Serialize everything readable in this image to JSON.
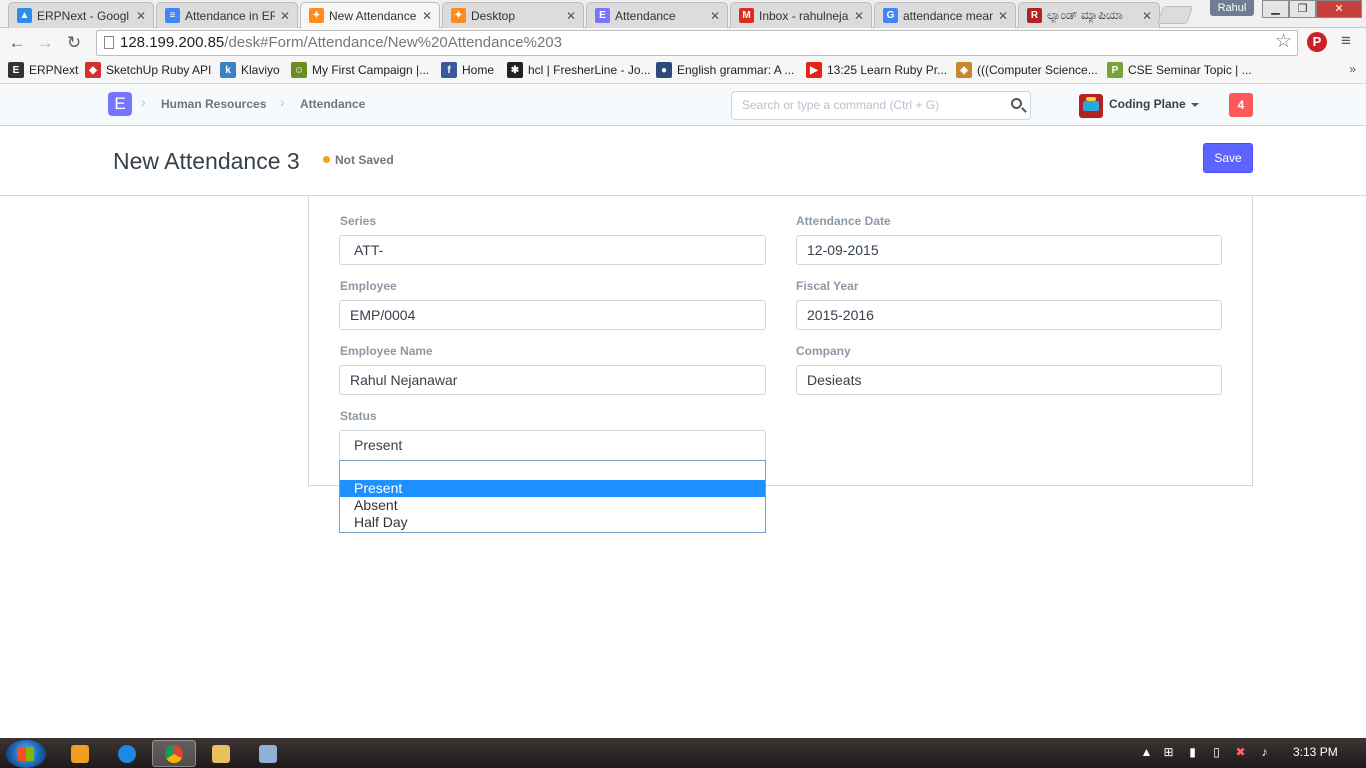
{
  "browser": {
    "tabs": [
      {
        "label": "ERPNext - Googl",
        "icon": "google-drive-icon",
        "color": "#2d8cf0"
      },
      {
        "label": "Attendance in ER",
        "icon": "google-docs-icon",
        "color": "#4285f4"
      },
      {
        "label": "New Attendance",
        "icon": "erpnext-desk-icon",
        "color": "#ff8c1a"
      },
      {
        "label": "Desktop",
        "icon": "erpnext-desk-icon",
        "color": "#ff8c1a"
      },
      {
        "label": "Attendance",
        "icon": "erpnext-e-icon",
        "color": "#7575ff"
      },
      {
        "label": "Inbox - rahulneja",
        "icon": "gmail-icon",
        "color": "#d93025"
      },
      {
        "label": "attendance mean",
        "icon": "google-icon",
        "color": "#4285f4"
      },
      {
        "label": "ಲ್ಯಾಂಡ್ ಮ್ಯಾಪಿಯಾ",
        "icon": "r-icon",
        "color": "#b22222"
      }
    ],
    "user_badge": "Rahul",
    "url_host": "128.199.200.85",
    "url_path": "/desk#Form/Attendance/New%20Attendance%203",
    "bookmarks": [
      {
        "label": "ERPNext",
        "icon": "erpnext-e-icon",
        "color": "#333"
      },
      {
        "label": "SketchUp Ruby API",
        "icon": "sketchup-icon",
        "color": "#d32f2f"
      },
      {
        "label": "Klaviyo",
        "icon": "klaviyo-icon",
        "color": "#3b82c4"
      },
      {
        "label": "My First Campaign |...",
        "icon": "campaign-icon",
        "color": "#6b8e23"
      },
      {
        "label": "Home",
        "icon": "facebook-icon",
        "color": "#3b5998"
      },
      {
        "label": "hcl | FresherLine - Jo...",
        "icon": "runner-icon",
        "color": "#222"
      },
      {
        "label": "English grammar: A ...",
        "icon": "bug-icon",
        "color": "#2e4a7a"
      },
      {
        "label": "13:25 Learn Ruby Pr...",
        "icon": "youtube-icon",
        "color": "#e62117"
      },
      {
        "label": "(((Computer Science...",
        "icon": "shield-icon",
        "color": "#c8872d"
      },
      {
        "label": "CSE Seminar Topic | ...",
        "icon": "p-icon",
        "color": "#7aa33a"
      }
    ]
  },
  "app": {
    "logo_letter": "E",
    "breadcrumbs": [
      "Human Resources",
      "Attendance"
    ],
    "search_placeholder": "Search or type a command (Ctrl + G)",
    "user_name": "Coding Plane",
    "notification_count": "4"
  },
  "page": {
    "title": "New Attendance 3",
    "status": "Not Saved",
    "save_label": "Save"
  },
  "form": {
    "series_label": "Series",
    "series_value": "ATT-",
    "attendance_date_label": "Attendance Date",
    "attendance_date_value": "12-09-2015",
    "employee_label": "Employee",
    "employee_value": "EMP/0004",
    "fiscal_year_label": "Fiscal Year",
    "fiscal_year_value": "2015-2016",
    "employee_name_label": "Employee Name",
    "employee_name_value": "Rahul Nejanawar",
    "company_label": "Company",
    "company_value": "Desieats",
    "status_label": "Status",
    "status_value": "Present",
    "status_options": [
      "",
      "Present",
      "Absent",
      "Half Day"
    ]
  },
  "taskbar": {
    "time": "3:13 PM"
  }
}
